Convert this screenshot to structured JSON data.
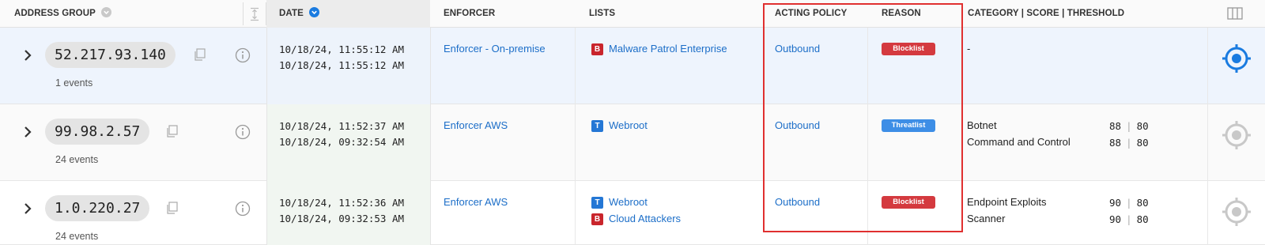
{
  "header": {
    "address_group": "ADDRESS GROUP",
    "date": "DATE",
    "enforcer": "ENFORCER",
    "lists": "LISTS",
    "acting_policy": "ACTING POLICY",
    "reason": "REASON",
    "category": "CATEGORY | SCORE | THRESHOLD"
  },
  "colors": {
    "link": "#1c6ec8",
    "blocklist": "#d43a3f",
    "threatlist": "#3d8ee6",
    "target_active": "#1a7be0",
    "target_inactive": "#c8c8c8",
    "highlight": "#e03030"
  },
  "rows": [
    {
      "ip": "52.217.93.140",
      "events": "1 events",
      "dates": [
        "10/18/24, 11:55:12 AM",
        "10/18/24, 11:55:12 AM"
      ],
      "enforcer": "Enforcer - On-premise",
      "lists": [
        {
          "badge": "B",
          "name": "Malware Patrol Enterprise"
        }
      ],
      "policy": "Outbound",
      "reason": "Blocklist",
      "category_text": "-",
      "categories": [],
      "active": true
    },
    {
      "ip": "99.98.2.57",
      "events": "24 events",
      "dates": [
        "10/18/24, 11:52:37 AM",
        "10/18/24, 09:32:54 AM"
      ],
      "enforcer": "Enforcer AWS",
      "lists": [
        {
          "badge": "T",
          "name": "Webroot"
        }
      ],
      "policy": "Outbound",
      "reason": "Threatlist",
      "categories": [
        {
          "name": "Botnet",
          "score": "88",
          "threshold": "80"
        },
        {
          "name": "Command and Control",
          "score": "88",
          "threshold": "80"
        }
      ],
      "active": false
    },
    {
      "ip": "1.0.220.27",
      "events": "24 events",
      "dates": [
        "10/18/24, 11:52:36 AM",
        "10/18/24, 09:32:53 AM"
      ],
      "enforcer": "Enforcer AWS",
      "lists": [
        {
          "badge": "T",
          "name": "Webroot"
        },
        {
          "badge": "B",
          "name": "Cloud Attackers"
        }
      ],
      "policy": "Outbound",
      "reason": "Blocklist",
      "categories": [
        {
          "name": "Endpoint Exploits",
          "score": "90",
          "threshold": "80"
        },
        {
          "name": "Scanner",
          "score": "90",
          "threshold": "80"
        }
      ],
      "active": false
    }
  ]
}
